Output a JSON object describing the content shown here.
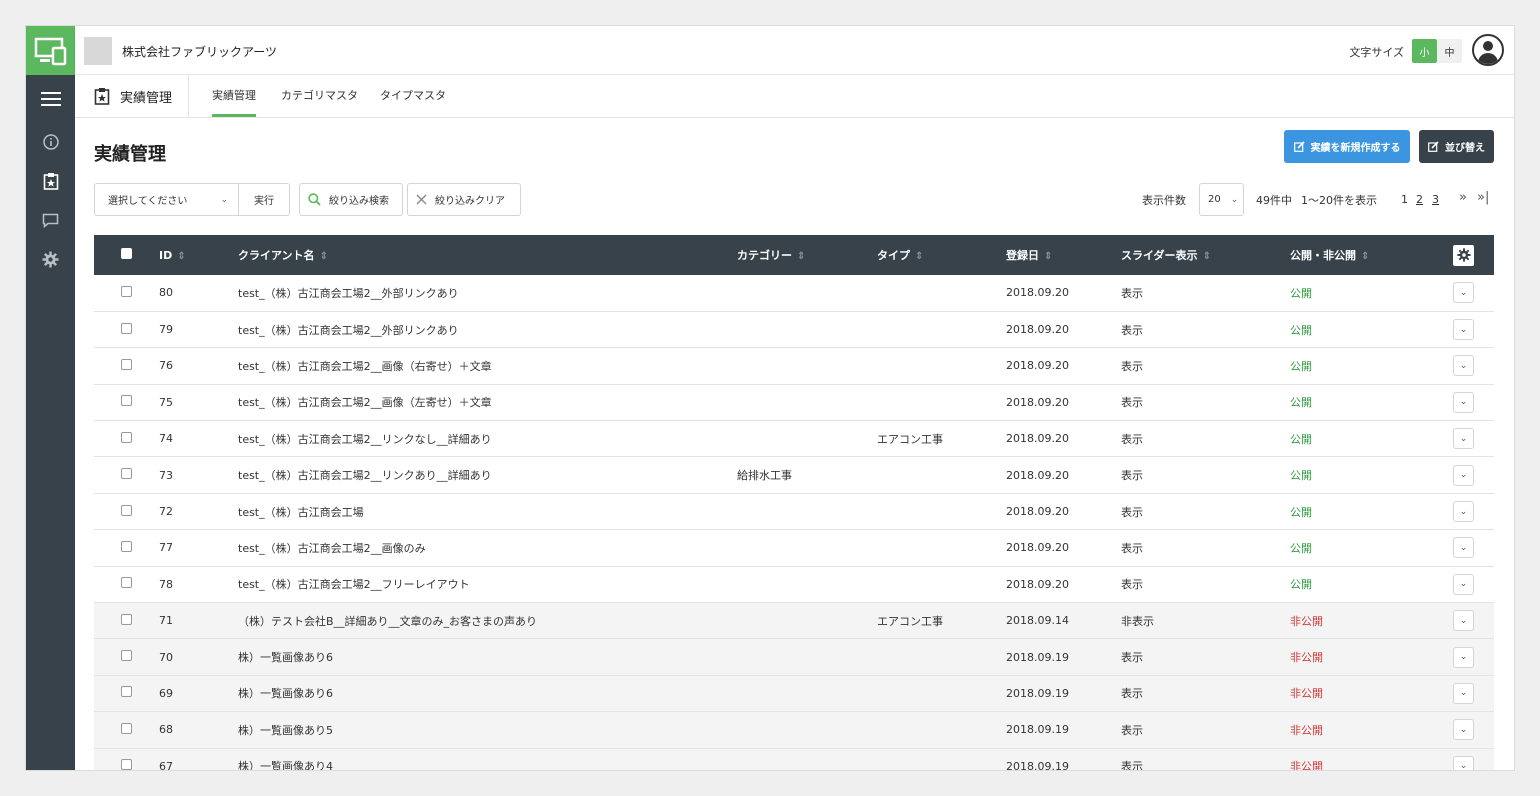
{
  "topbar": {
    "company_name": "株式会社ファブリックアーツ",
    "font_size_label": "文字サイズ",
    "font_small": "小",
    "font_medium": "中"
  },
  "subnav": {
    "title": "実績管理",
    "tabs": [
      {
        "label": "実績管理",
        "active": true
      },
      {
        "label": "カテゴリマスタ",
        "active": false
      },
      {
        "label": "タイプマスタ",
        "active": false
      }
    ]
  },
  "main": {
    "page_title": "実績管理",
    "new_button": "実績を新規作成する",
    "sort_button": "並び替え",
    "select_placeholder": "選択してください",
    "run_button": "実行",
    "search_button": "絞り込み検索",
    "clear_button": "絞り込みクリア",
    "per_page_label": "表示件数",
    "per_page_value": "20",
    "total": "49件中",
    "range": "1〜20件を表示",
    "pages": [
      "1",
      "2",
      "3"
    ],
    "next": "»",
    "last": "»|"
  },
  "table": {
    "headers": [
      "ID",
      "クライアント名",
      "カテゴリー",
      "タイプ",
      "登録日",
      "スライダー表示",
      "公開・非公開"
    ],
    "rows": [
      {
        "id": "80",
        "client": "test_（株）古江商会工場2__外部リンクあり",
        "category": "",
        "type": "",
        "date": "2018.09.20",
        "slider": "表示",
        "status": "公開",
        "published": true
      },
      {
        "id": "79",
        "client": "test_（株）古江商会工場2__外部リンクあり",
        "category": "",
        "type": "",
        "date": "2018.09.20",
        "slider": "表示",
        "status": "公開",
        "published": true
      },
      {
        "id": "76",
        "client": "test_（株）古江商会工場2__画像（右寄せ）＋文章",
        "category": "",
        "type": "",
        "date": "2018.09.20",
        "slider": "表示",
        "status": "公開",
        "published": true
      },
      {
        "id": "75",
        "client": "test_（株）古江商会工場2__画像（左寄せ）＋文章",
        "category": "",
        "type": "",
        "date": "2018.09.20",
        "slider": "表示",
        "status": "公開",
        "published": true
      },
      {
        "id": "74",
        "client": "test_（株）古江商会工場2__リンクなし__詳細あり",
        "category": "",
        "type": "エアコン工事",
        "date": "2018.09.20",
        "slider": "表示",
        "status": "公開",
        "published": true
      },
      {
        "id": "73",
        "client": "test_（株）古江商会工場2__リンクあり__詳細あり",
        "category": "給排水工事",
        "type": "",
        "date": "2018.09.20",
        "slider": "表示",
        "status": "公開",
        "published": true
      },
      {
        "id": "72",
        "client": "test_（株）古江商会工場",
        "category": "",
        "type": "",
        "date": "2018.09.20",
        "slider": "表示",
        "status": "公開",
        "published": true
      },
      {
        "id": "77",
        "client": "test_（株）古江商会工場2__画像のみ",
        "category": "",
        "type": "",
        "date": "2018.09.20",
        "slider": "表示",
        "status": "公開",
        "published": true
      },
      {
        "id": "78",
        "client": "test_（株）古江商会工場2__フリーレイアウト",
        "category": "",
        "type": "",
        "date": "2018.09.20",
        "slider": "表示",
        "status": "公開",
        "published": true
      },
      {
        "id": "71",
        "client": "（株）テスト会社B__詳細あり__文章のみ_お客さまの声あり",
        "category": "",
        "type": "エアコン工事",
        "date": "2018.09.14",
        "slider": "非表示",
        "status": "非公開",
        "published": false
      },
      {
        "id": "70",
        "client": "株）一覧画像あり6",
        "category": "",
        "type": "",
        "date": "2018.09.19",
        "slider": "表示",
        "status": "非公開",
        "published": false
      },
      {
        "id": "69",
        "client": "株）一覧画像あり6",
        "category": "",
        "type": "",
        "date": "2018.09.19",
        "slider": "表示",
        "status": "非公開",
        "published": false
      },
      {
        "id": "68",
        "client": "株）一覧画像あり5",
        "category": "",
        "type": "",
        "date": "2018.09.19",
        "slider": "表示",
        "status": "非公開",
        "published": false
      },
      {
        "id": "67",
        "client": "株）一覧画像あり4",
        "category": "",
        "type": "",
        "date": "2018.09.19",
        "slider": "表示",
        "status": "非公開",
        "published": false
      }
    ]
  },
  "colors": {
    "accent": "#5bb85f",
    "primary": "#3b95e0",
    "dark": "#37424b",
    "published": "#2e9a3d",
    "unpublished": "#d03a3a"
  }
}
